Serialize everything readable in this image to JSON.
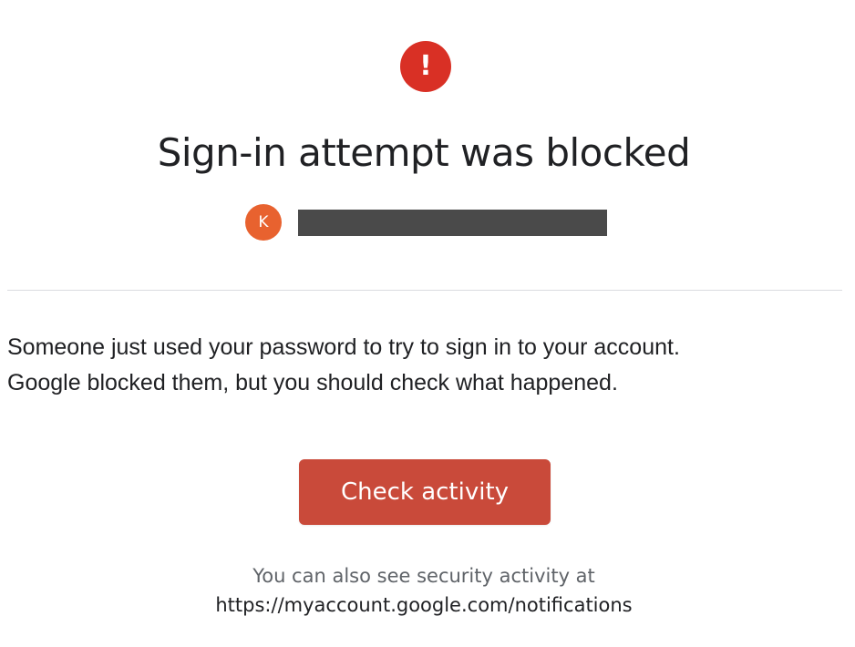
{
  "alert": {
    "icon": "exclamation-icon",
    "glyph": "!",
    "color": "#d93025"
  },
  "title": "Sign-in attempt was blocked",
  "account": {
    "avatar_initial": "K",
    "avatar_color": "#e8622f",
    "email": ""
  },
  "message": {
    "line1": "Someone just used your password to try to sign in to your account.",
    "line2": "Google blocked them, but you should check what happened."
  },
  "cta": {
    "label": "Check activity",
    "color": "#c94a3a"
  },
  "footer": {
    "note": "You can also see security activity at",
    "link": "https://myaccount.google.com/notifications"
  }
}
